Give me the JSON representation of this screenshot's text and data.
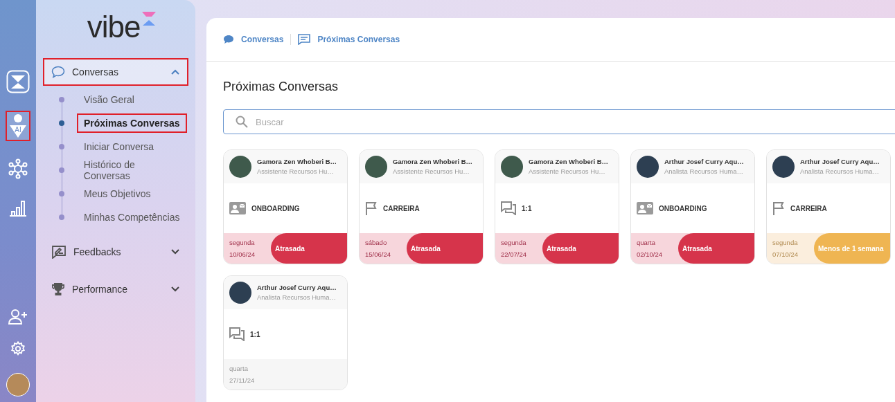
{
  "rail": {
    "items": [
      {
        "kind": "logo",
        "highlighted": false
      },
      {
        "kind": "ai-person",
        "highlighted": true,
        "label": "AI"
      },
      {
        "kind": "network",
        "highlighted": false
      },
      {
        "kind": "chart",
        "highlighted": false
      }
    ],
    "bottom": [
      {
        "kind": "add-user"
      },
      {
        "kind": "settings"
      },
      {
        "kind": "avatar"
      }
    ]
  },
  "sidebar": {
    "logo": "vibe",
    "groups": [
      {
        "label": "Conversas",
        "kind": "chat",
        "expanded": true,
        "highlighted": true,
        "children": [
          {
            "label": "Visão Geral",
            "selected": false,
            "highlighted": false
          },
          {
            "label": "Próximas Conversas",
            "selected": true,
            "highlighted": true
          },
          {
            "label": "Iniciar Conversa",
            "selected": false,
            "highlighted": false
          },
          {
            "label": "Histórico de Conversas",
            "selected": false,
            "highlighted": false
          },
          {
            "label": "Meus Objetivos",
            "selected": false,
            "highlighted": false
          },
          {
            "label": "Minhas Competências",
            "selected": false,
            "highlighted": false
          }
        ]
      },
      {
        "label": "Feedbacks",
        "kind": "feedback",
        "expanded": false,
        "highlighted": false
      },
      {
        "label": "Performance",
        "kind": "trophy",
        "expanded": false,
        "highlighted": false
      }
    ]
  },
  "breadcrumb": [
    {
      "label": "Conversas",
      "kind": "bubble"
    },
    {
      "label": "Próximas Conversas",
      "kind": "message"
    }
  ],
  "title": "Próximas Conversas",
  "search": {
    "placeholder": "Buscar"
  },
  "cards": [
    {
      "name": "Gamora Zen Whoberi B…",
      "role": "Assistente Recursos Hu…",
      "kind": "onboarding",
      "type_label": "ONBOARDING",
      "day": "segunda",
      "date": "10/06/24",
      "status": {
        "kind": "overdue",
        "label": "Atrasada"
      }
    },
    {
      "name": "Gamora Zen Whoberi B…",
      "role": "Assistente Recursos Hu…",
      "kind": "career",
      "type_label": "CARREIRA",
      "day": "sábado",
      "date": "15/06/24",
      "status": {
        "kind": "overdue",
        "label": "Atrasada"
      }
    },
    {
      "name": "Gamora Zen Whoberi B…",
      "role": "Assistente Recursos Hu…",
      "kind": "one-on-one",
      "type_label": "1:1",
      "day": "segunda",
      "date": "22/07/24",
      "status": {
        "kind": "overdue",
        "label": "Atrasada"
      }
    },
    {
      "name": "Arthur Josef Curry Aqu…",
      "role": "Analista Recursos Huma…",
      "kind": "onboarding",
      "type_label": "ONBOARDING",
      "day": "quarta",
      "date": "02/10/24",
      "status": {
        "kind": "overdue",
        "label": "Atrasada"
      }
    },
    {
      "name": "Arthur Josef Curry Aqu…",
      "role": "Analista Recursos Huma…",
      "kind": "career",
      "type_label": "CARREIRA",
      "day": "segunda",
      "date": "07/10/24",
      "status": {
        "kind": "soon",
        "label": "Menos de 1 semana"
      }
    },
    {
      "name": "Arthur Josef Curry Aqu…",
      "role": "Analista Recursos Huma…",
      "kind": "one-on-one",
      "type_label": "1:1",
      "day": "quarta",
      "date": "27/11/24"
    }
  ]
}
